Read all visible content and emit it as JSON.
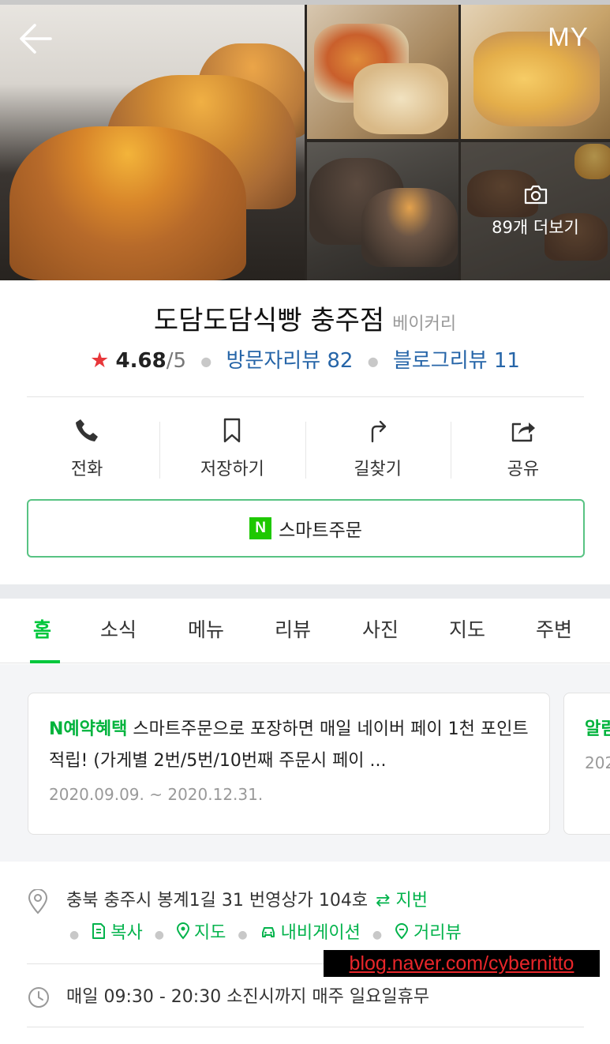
{
  "header": {
    "back_label": "←",
    "my_label": "MY",
    "more_photos_label": "89개 더보기"
  },
  "place": {
    "name": "도담도담식빵 충주점",
    "category": "베이커리",
    "rating": "4.68",
    "rating_max": "/5",
    "visitor_reviews": "방문자리뷰 82",
    "blog_reviews": "블로그리뷰 11"
  },
  "actions": [
    {
      "label": "전화",
      "icon": "phone-icon"
    },
    {
      "label": "저장하기",
      "icon": "bookmark-icon"
    },
    {
      "label": "길찾기",
      "icon": "directions-icon"
    },
    {
      "label": "공유",
      "icon": "share-icon"
    }
  ],
  "smart_order": {
    "logo": "N",
    "label": "스마트주문"
  },
  "tabs": [
    "홈",
    "소식",
    "메뉴",
    "리뷰",
    "사진",
    "지도",
    "주변"
  ],
  "active_tab": "홈",
  "feed": {
    "main": {
      "highlight": "N예약혜택",
      "text": " 스마트주문으로 포장하면 매일 네이버 페이 1천 포인트 적립! (가게별 2번/5번/10번째 주문시 페이 ...",
      "date": "2020.09.09. ~ 2020.12.31."
    },
    "peek": {
      "highlight": "알림",
      "date": "202"
    }
  },
  "info": {
    "address": "충북 충주시 봉계1길 31 번영상가 104호",
    "lot_number_label": "⇄ 지번",
    "links": [
      "복사",
      "지도",
      "내비게이션",
      "거리뷰"
    ],
    "hours": "매일 09:30 - 20:30 소진시까지 매주 일요일휴무"
  },
  "watermark": "blog.naver.com/cybernitto",
  "colors": {
    "accent_green": "#00c73c",
    "link_blue": "#2665a8",
    "star_red": "#e8373a"
  }
}
